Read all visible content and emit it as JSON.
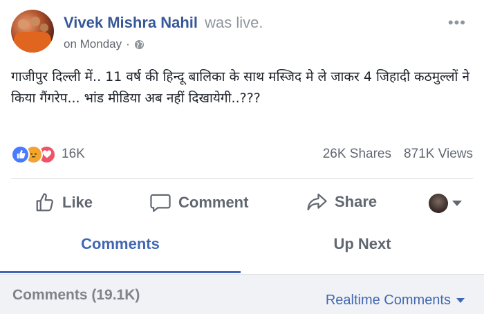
{
  "post": {
    "author": "Vivek Mishra Nahil",
    "status": "was live.",
    "timestamp": "on Monday",
    "separator": "·",
    "privacy_icon": "globe-icon",
    "more_label": "•••",
    "text": "गाजीपुर दिल्ली में.. 11 वर्ष की हिन्दू बालिका के साथ मस्जिद मे ले जाकर 4 जिहादी कठमुल्लों ने किया गैंगरेप... भांड मीडिया अब नहीं दिखायेगी..???"
  },
  "stats": {
    "reaction_icons": [
      "like-icon",
      "angry-icon",
      "love-icon"
    ],
    "reaction_count": "16K",
    "shares": "26K Shares",
    "views": "871K Views"
  },
  "actions": {
    "like": "Like",
    "comment": "Comment",
    "share": "Share"
  },
  "tabs": {
    "comments": "Comments",
    "up_next": "Up Next"
  },
  "comments_bar": {
    "count_label": "Comments (19.1K)",
    "sort_label": "Realtime Comments"
  },
  "colors": {
    "link": "#365899",
    "accent": "#4267b2",
    "muted": "#606770",
    "like": "#4a7aff",
    "angry": "#f0a23b",
    "love": "#f25268"
  }
}
